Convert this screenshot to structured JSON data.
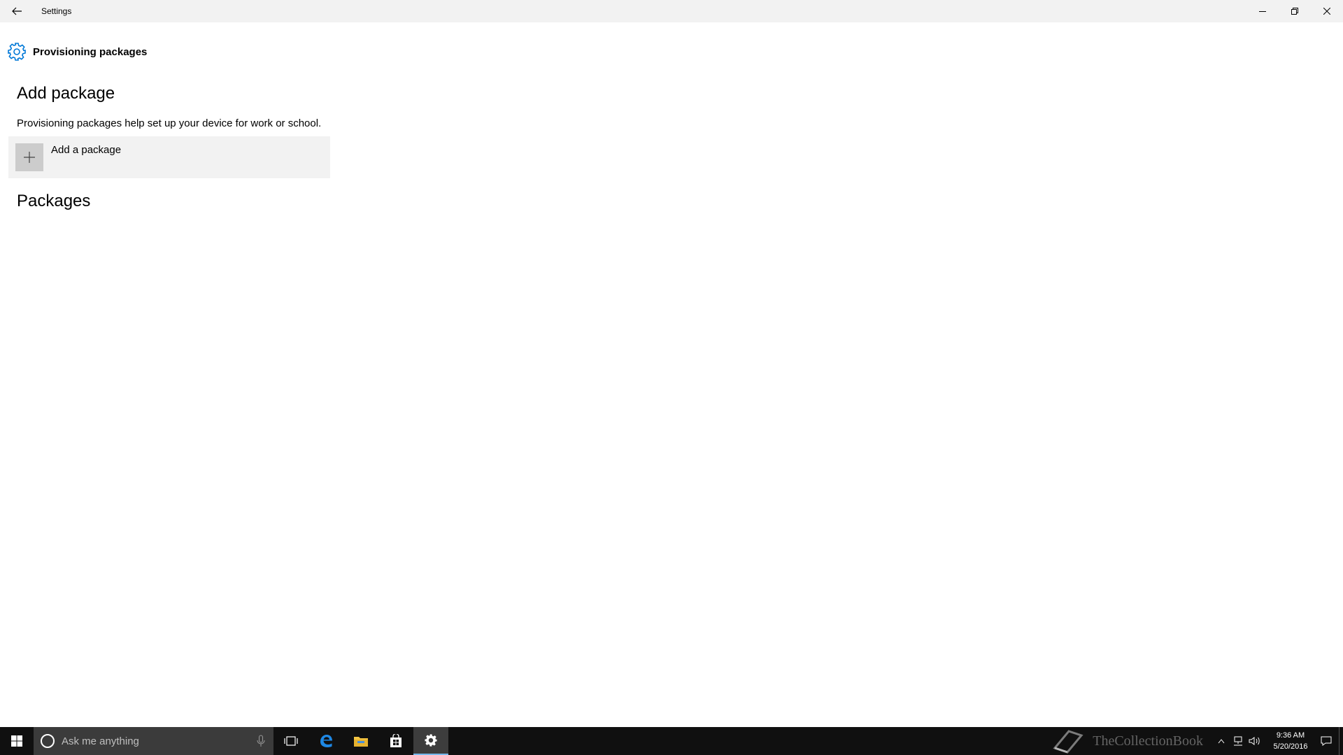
{
  "window": {
    "title": "Settings"
  },
  "header": {
    "page_title": "Provisioning packages"
  },
  "add_section": {
    "heading": "Add package",
    "description": "Provisioning packages help set up your device for work or school.",
    "add_button_label": "Add a package"
  },
  "packages_section": {
    "heading": "Packages"
  },
  "taskbar": {
    "search_placeholder": "Ask me anything",
    "apps": [
      "task-view",
      "edge",
      "file-explorer",
      "store",
      "settings"
    ],
    "active_app": "settings",
    "clock_time": "9:36 AM",
    "clock_date": "5/20/2016",
    "watermark": "TheCollectionBook"
  },
  "colors": {
    "accent": "#0078d7",
    "titlebar_bg": "#f2f2f2",
    "taskbar_bg": "#101010",
    "search_bg": "#3b3b3b"
  }
}
